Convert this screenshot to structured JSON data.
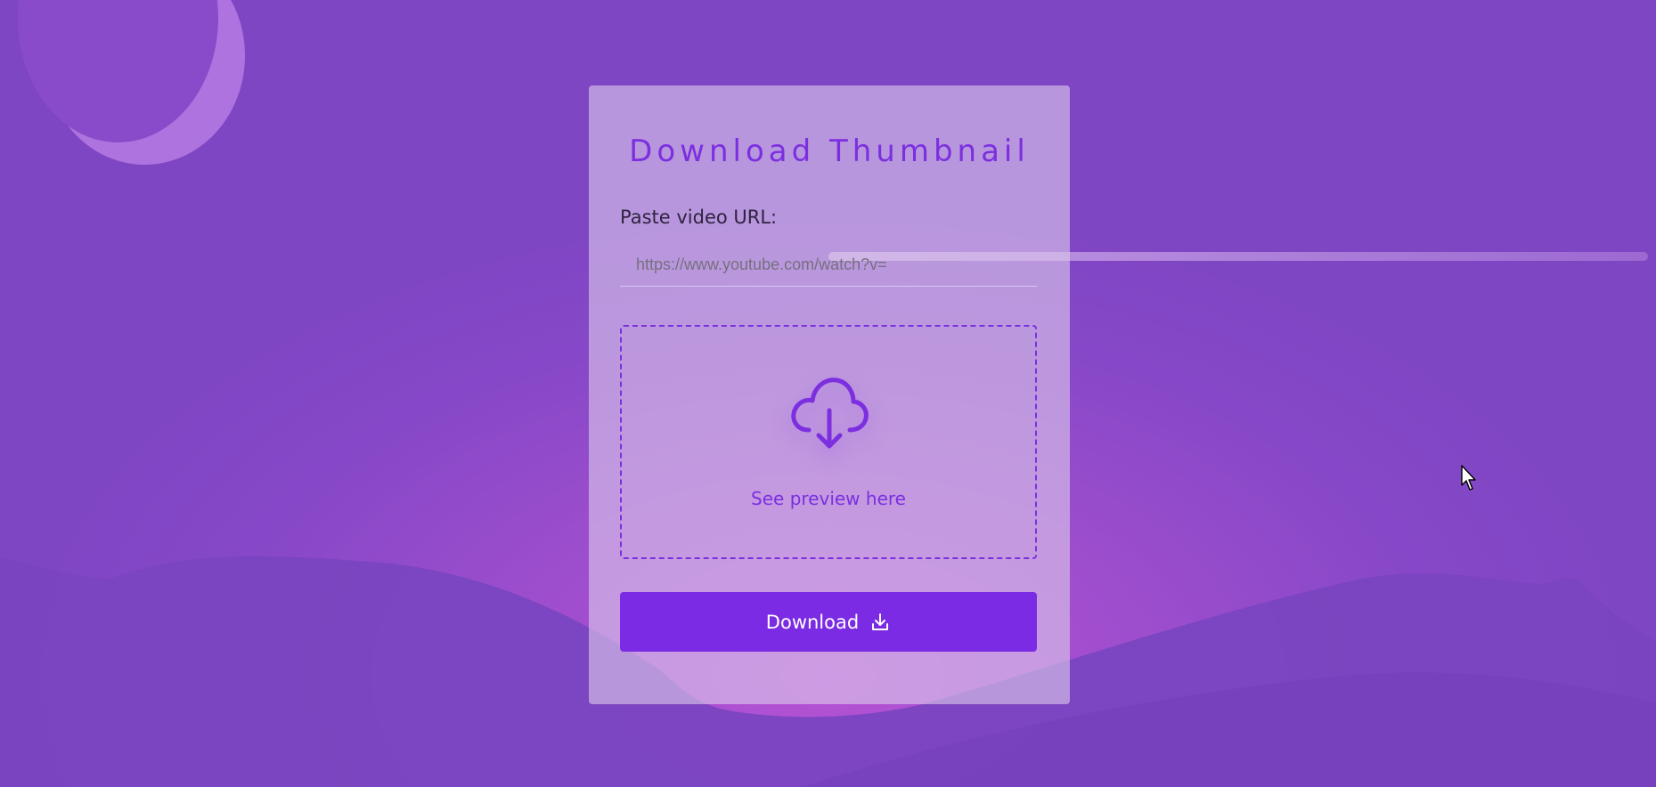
{
  "page": {
    "title": "Download Thumbnail"
  },
  "form": {
    "url_label": "Paste video URL:",
    "url_placeholder": "https://www.youtube.com/watch?v=",
    "url_value": ""
  },
  "preview": {
    "text": "See preview here",
    "icon": "cloud-download-icon"
  },
  "actions": {
    "download_label": "Download",
    "download_icon": "download-icon"
  },
  "colors": {
    "accent": "#7b2be3",
    "title": "#7b2fdf",
    "background": "#8a4bca"
  }
}
